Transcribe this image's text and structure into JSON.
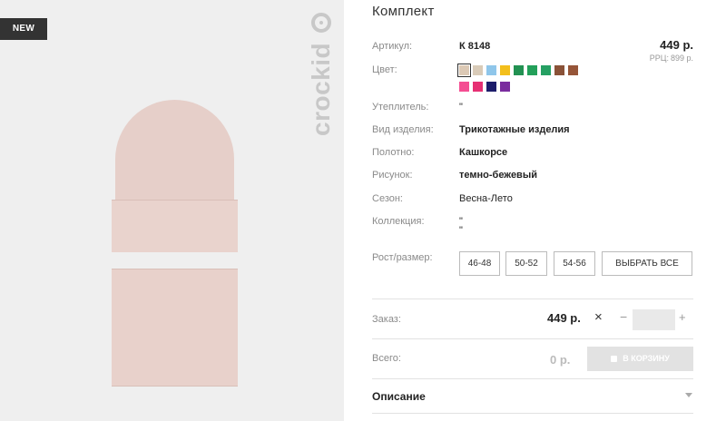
{
  "badge": "NEW",
  "brand": "crockid",
  "title": "Комплект",
  "price": "449 р.",
  "rrc": {
    "label": "РРЦ:",
    "value": "899 р."
  },
  "details": {
    "article": {
      "label": "Артикул:",
      "value": "К 8148"
    },
    "color": {
      "label": "Цвет:"
    },
    "insulation": {
      "label": "Утеплитель:",
      "value": "\""
    },
    "product_type": {
      "label": "Вид изделия:",
      "value": "Трикотажные изделия"
    },
    "fabric": {
      "label": "Полотно:",
      "value": "Кашкорсе"
    },
    "pattern": {
      "label": "Рисунок:",
      "value": "темно-бежевый"
    },
    "season": {
      "label": "Сезон:",
      "value": "Весна-Лето"
    },
    "collection": {
      "label": "Коллекция:",
      "value": "\"",
      "value2": "\""
    },
    "size": {
      "label": "Рост/размер:"
    }
  },
  "colors": [
    "#dcc9b5",
    "#d9cbb8",
    "#8fc6ea",
    "#f3bf1c",
    "#229152",
    "#23a05a",
    "#26a063",
    "#8a5238",
    "#965538",
    "#f44e92",
    "#e63073",
    "#1d1d6b",
    "#7a2c9e"
  ],
  "selected_color_index": 0,
  "sizes": [
    "46-48",
    "50-52",
    "54-56"
  ],
  "select_all": "ВЫБРАТЬ ВСЕ",
  "order": {
    "label": "Заказ:",
    "price": "449 р.",
    "close": "×",
    "minus": "−",
    "plus": "+"
  },
  "total": {
    "label": "Всего:",
    "value": "0 р."
  },
  "cart_button": "В КОРЗИНУ",
  "description": "Описание"
}
